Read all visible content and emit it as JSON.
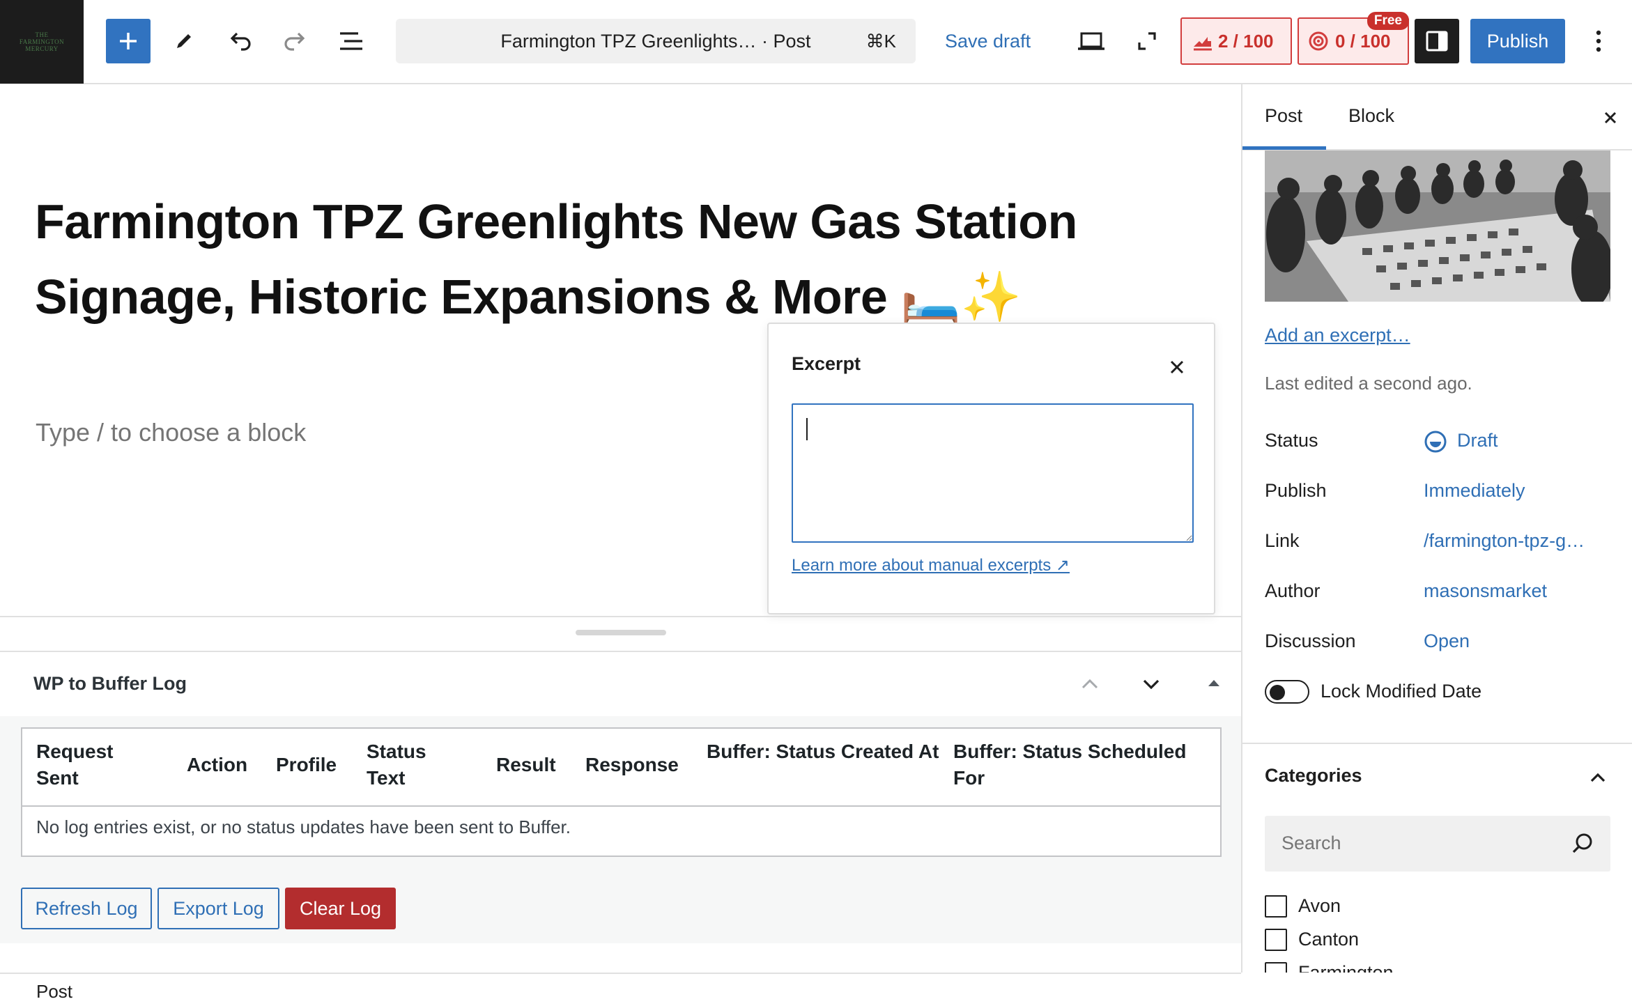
{
  "site": {
    "logo_text": "THE FARMINGTON MERCURY"
  },
  "toolbar": {
    "doc_title": "Farmington TPZ Greenlights…  · Post",
    "shortcut": "⌘K",
    "save_draft": "Save draft",
    "score_one": "2 / 100",
    "score_two": "0 / 100",
    "free_badge": "Free",
    "publish": "Publish"
  },
  "editor": {
    "post_title": "Farmington TPZ Greenlights New Gas Station Signage, Historic Expansions & More 🛏️✨",
    "placeholder": "Type / to choose a block"
  },
  "excerpt_popover": {
    "heading": "Excerpt",
    "value": "",
    "learn_more": "Learn more about manual excerpts ↗"
  },
  "buffer_log": {
    "title": "WP to Buffer Log",
    "columns": [
      "Request Sent",
      "Action",
      "Profile",
      "Status Text",
      "Result",
      "Response",
      "Buffer: Status Created At",
      "Buffer: Status Scheduled For"
    ],
    "empty_message": "No log entries exist, or no status updates have been sent to Buffer.",
    "refresh": "Refresh Log",
    "export": "Export Log",
    "clear": "Clear Log"
  },
  "footer": {
    "breadcrumb": "Post"
  },
  "sidebar": {
    "tabs": [
      "Post",
      "Block"
    ],
    "active_tab": "Post",
    "add_excerpt": "Add an excerpt…",
    "last_edited": "Last edited a second ago.",
    "rows": [
      {
        "label": "Status",
        "value": "Draft"
      },
      {
        "label": "Publish",
        "value": "Immediately"
      },
      {
        "label": "Link",
        "value": "/farmington-tpz-g…"
      },
      {
        "label": "Author",
        "value": "masonsmarket"
      },
      {
        "label": "Discussion",
        "value": "Open"
      }
    ],
    "lock_modified": "Lock Modified Date",
    "lock_modified_on": false,
    "categories": {
      "heading": "Categories",
      "search_placeholder": "Search",
      "items": [
        "Avon",
        "Canton",
        "Farmington"
      ]
    }
  },
  "colors": {
    "accent": "#3173c0",
    "danger": "#b32d2e",
    "score_bg": "#fdeaea"
  },
  "icons": [
    "plus-icon",
    "pencil-icon",
    "undo-icon",
    "redo-icon",
    "list-view-icon",
    "desktop-preview-icon",
    "fullscreen-icon",
    "seo-graph-icon",
    "readability-icon",
    "sidebar-toggle-icon",
    "more-vertical-icon",
    "close-icon",
    "chevron-up-icon",
    "chevron-down-icon",
    "triangle-up-icon",
    "search-icon",
    "draft-status-icon"
  ]
}
